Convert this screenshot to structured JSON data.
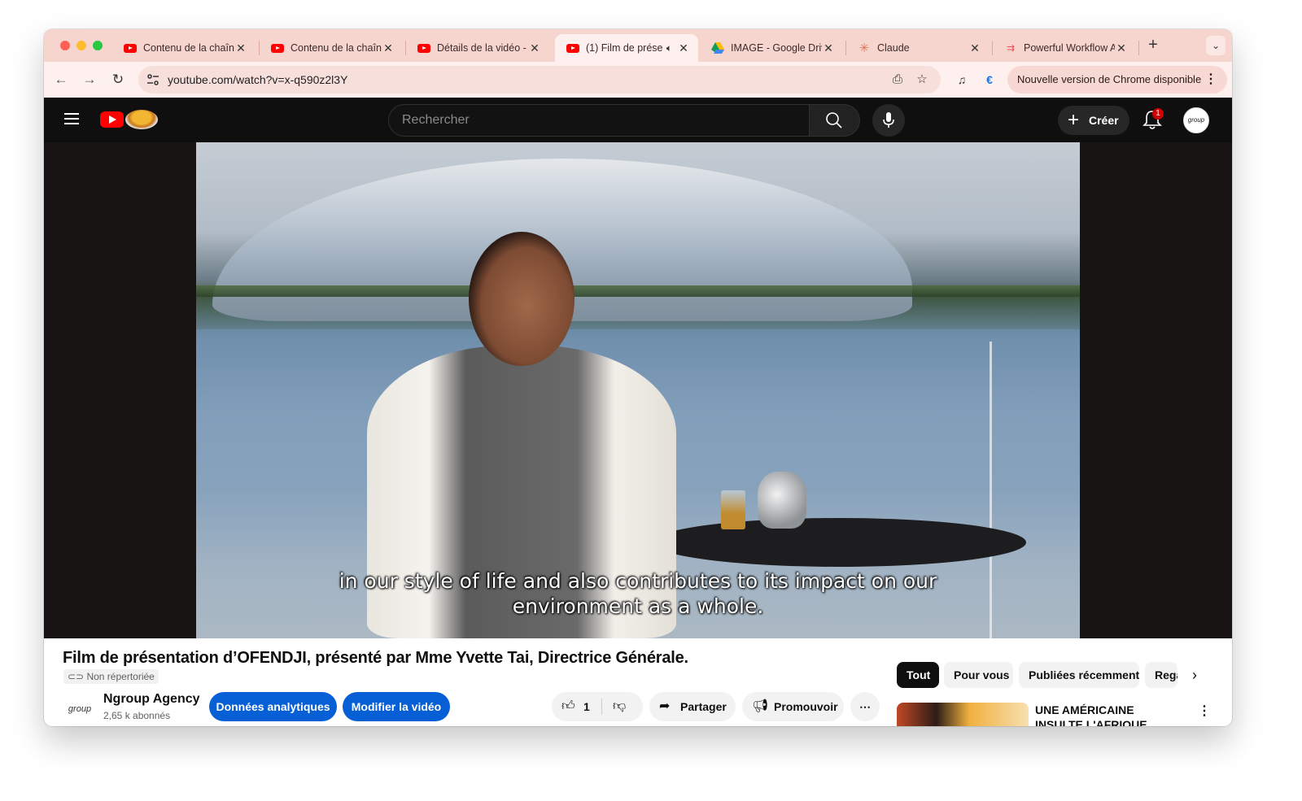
{
  "browser": {
    "tabs": [
      {
        "title": "Contenu de la chaîne",
        "favicon": "youtube-icon"
      },
      {
        "title": "Contenu de la chaîne",
        "favicon": "youtube-icon"
      },
      {
        "title": "Détails de la vidéo -",
        "favicon": "youtube-icon"
      },
      {
        "title": "(1) Film de prése",
        "favicon": "youtube-icon",
        "active": true,
        "audio": "speaker-icon"
      },
      {
        "title": "IMAGE - Google Driv",
        "favicon": "google-drive-icon"
      },
      {
        "title": "Claude",
        "favicon": "claude-icon"
      },
      {
        "title": "Powerful Workflow A",
        "favicon": "workflow-icon"
      }
    ],
    "url": "youtube.com/watch?v=x-q590z2l3Y",
    "update_label": "Nouvelle version de Chrome disponible",
    "colors": {
      "tabstrip": "#f7d5cf",
      "toolbar": "#fdf0ee"
    }
  },
  "youtube": {
    "search_placeholder": "Rechercher",
    "create_label": "Créer",
    "notification_count": "1",
    "avatar_text": "group"
  },
  "video": {
    "subtitle_line1": "in our style of life and also contributes to its impact on our",
    "subtitle_line2": "environment as a whole.",
    "title": "Film de présentation d’OFENDJI, présenté par Mme Yvette Tai, Directrice Générale.",
    "visibility": "Non répertoriée"
  },
  "channel": {
    "name": "Ngroup Agency",
    "subscribers": "2,65 k abonnés",
    "avatar_text": "group"
  },
  "actions": {
    "analytics_label": "Données analytiques",
    "edit_label": "Modifier la vidéo",
    "like_count": "1",
    "share_label": "Partager",
    "promote_label": "Promouvoir",
    "more_label": "⋯"
  },
  "chips": [
    "Tout",
    "Pour vous",
    "Publiées récemment",
    "Regardées"
  ],
  "recommendation": {
    "title": "UNE AMÉRICAINE INSULTE L'AFRIQUE POUR AVOIR"
  }
}
